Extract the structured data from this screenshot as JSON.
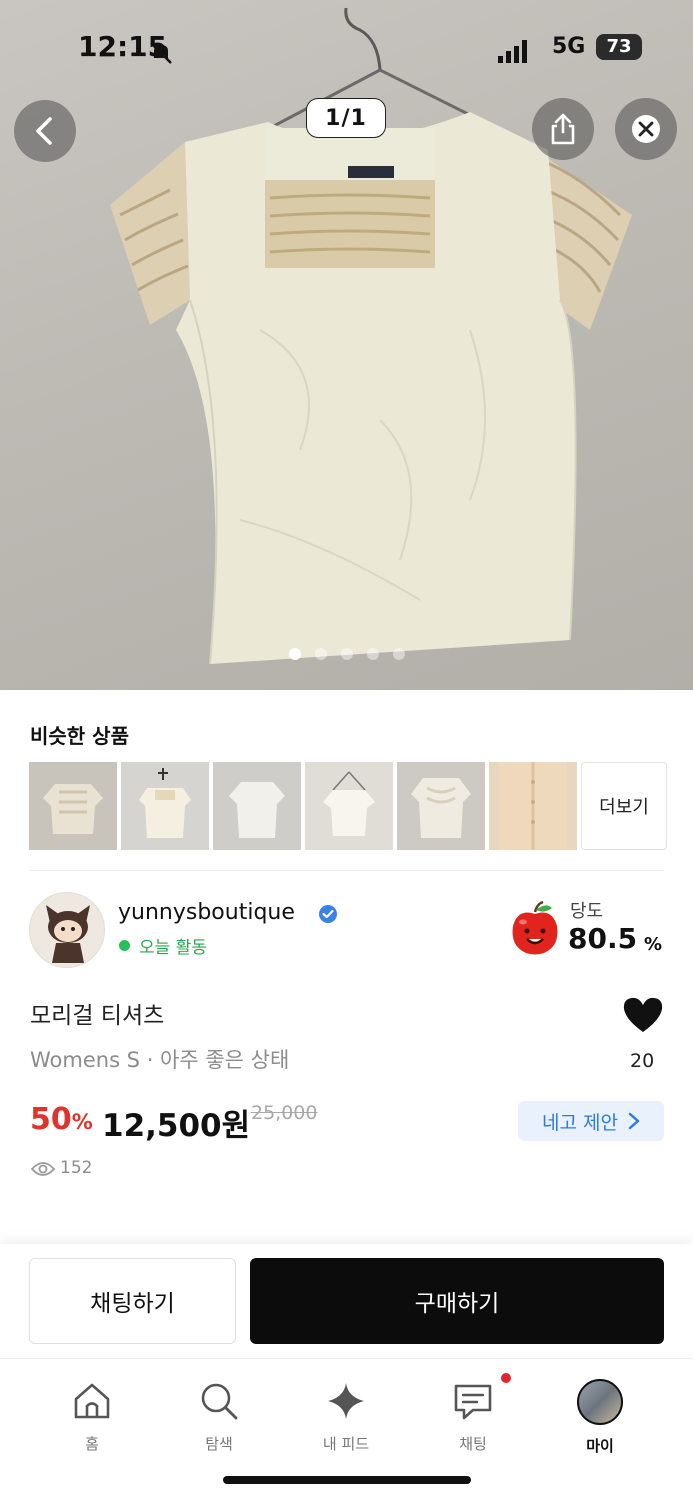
{
  "status_bar": {
    "time": "12:15",
    "network": "5G",
    "battery": "73"
  },
  "gallery": {
    "counter": "1/1",
    "dot_count": 5,
    "active_dot": 0
  },
  "similar": {
    "title": "비슷한 상품",
    "more_label": "더보기",
    "thumbnail_count": 6
  },
  "seller": {
    "name": "yunnysboutique",
    "activity": "오늘 활동",
    "sweetness_label": "당도",
    "sweetness_value": "80.5",
    "sweetness_unit": "%"
  },
  "product": {
    "title": "모리걸 티셔츠",
    "subtitle": "Womens S · 아주 좋은 상태",
    "likes": "20",
    "discount_value": "50",
    "discount_unit": "%",
    "price": "12,500원",
    "original_price": "25,000",
    "negotiate_label": "네고 제안",
    "views": "152"
  },
  "actions": {
    "chat_label": "채팅하기",
    "buy_label": "구매하기"
  },
  "tabs": [
    {
      "label": "홈",
      "icon": "home-icon"
    },
    {
      "label": "탐색",
      "icon": "search-icon"
    },
    {
      "label": "내 피드",
      "icon": "sparkle-icon"
    },
    {
      "label": "채팅",
      "icon": "chat-icon"
    },
    {
      "label": "마이",
      "icon": "avatar-icon"
    }
  ],
  "colors": {
    "discount": "#e0332d",
    "active_green": "#25c05a",
    "negotiate_bg": "#e8f1fc",
    "negotiate_text": "#2c7be5",
    "buy_bg": "#0c0c0c",
    "notification": "#e3262e"
  }
}
